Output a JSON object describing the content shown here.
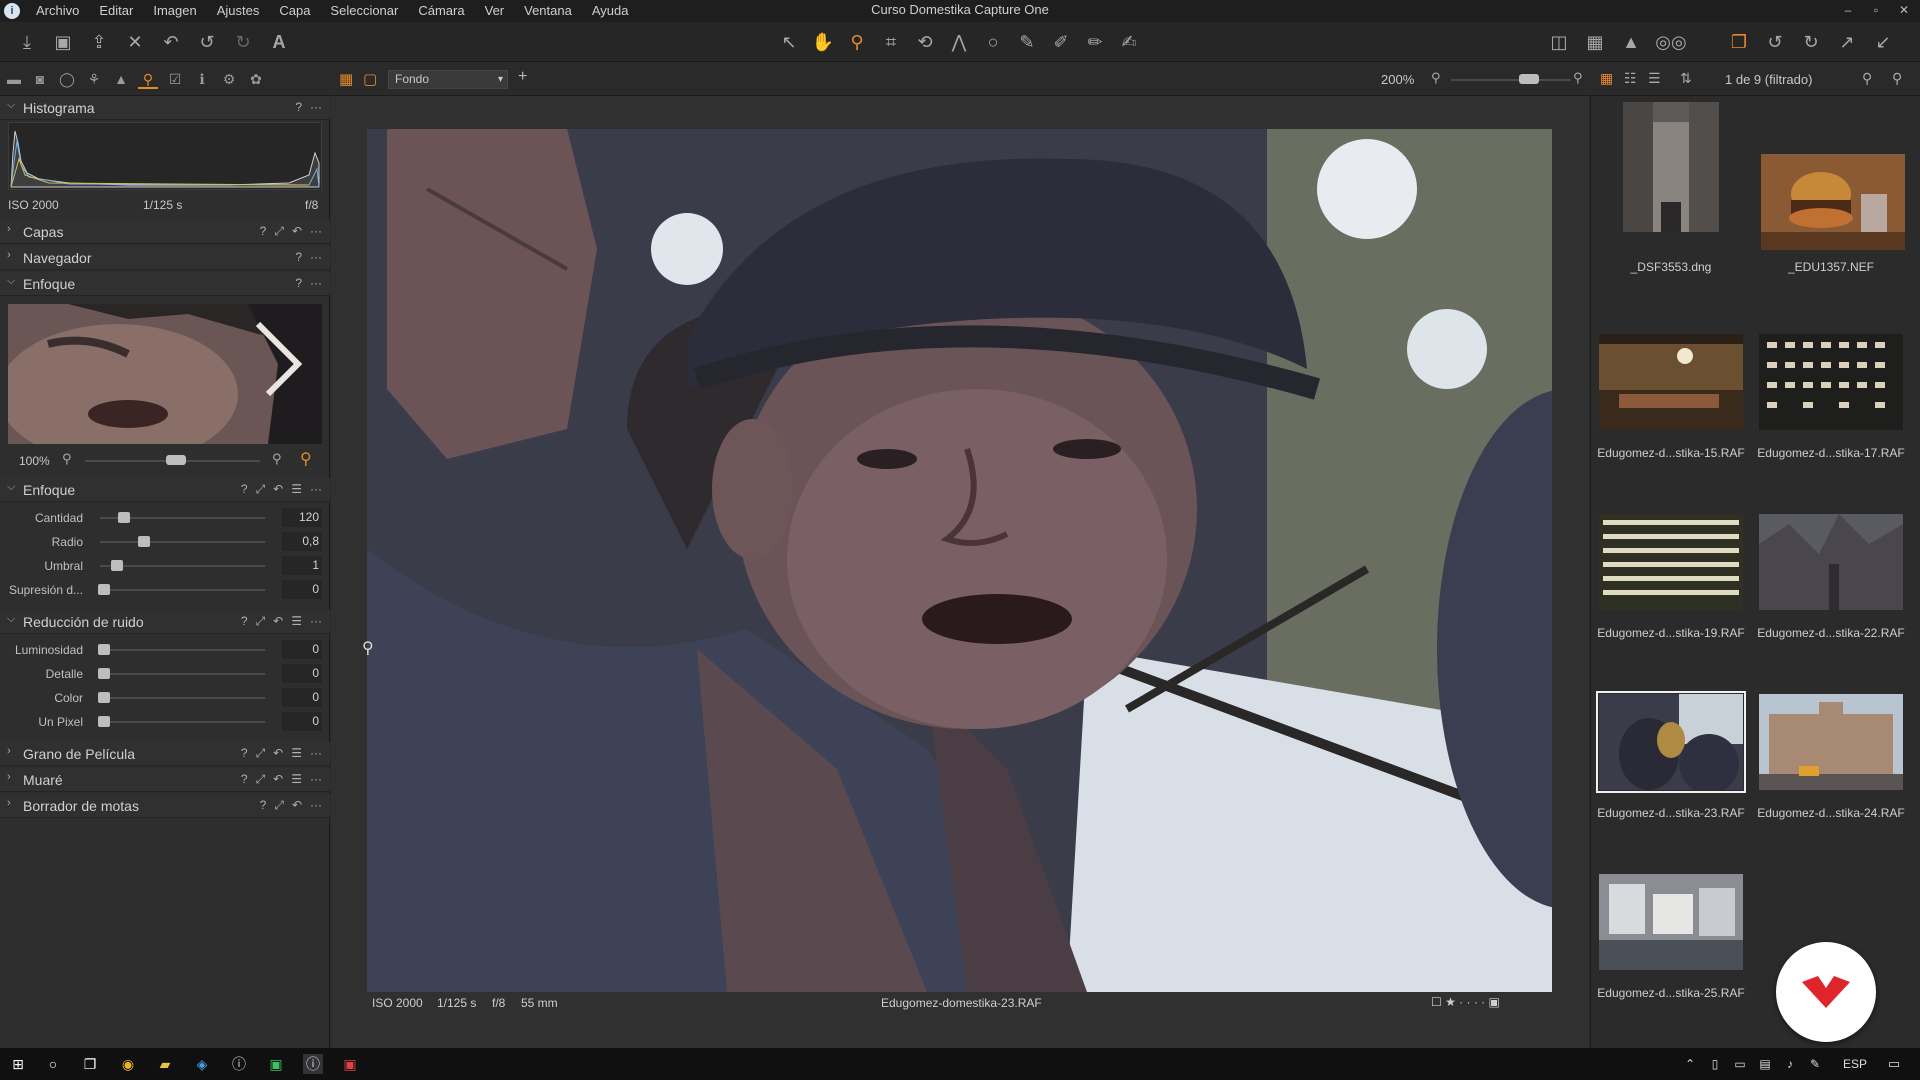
{
  "app": {
    "title": "Curso Domestika Capture One",
    "menu": [
      "Archivo",
      "Editar",
      "Imagen",
      "Ajustes",
      "Capa",
      "Seleccionar",
      "Cámara",
      "Ver",
      "Ventana",
      "Ayuda"
    ],
    "window_controls": [
      "–",
      "▫",
      "✕"
    ]
  },
  "accent_color": "#e6892d",
  "left_panel": {
    "histogram": {
      "title": "Histograma",
      "iso": "ISO 2000",
      "shutter": "1/125 s",
      "aperture": "f/8"
    },
    "layers": {
      "title": "Capas"
    },
    "navigator": {
      "title": "Navegador"
    },
    "focus_tool": {
      "title": "Enfoque",
      "zoom": "100%"
    },
    "sharpening": {
      "title": "Enfoque",
      "sliders": [
        {
          "label": "Cantidad",
          "value": "120",
          "level": 0.12
        },
        {
          "label": "Radio",
          "value": "0,8",
          "level": 0.24
        },
        {
          "label": "Umbral",
          "value": "1",
          "level": 0.08
        },
        {
          "label": "Supresión d...",
          "value": "0",
          "level": 0.0
        }
      ]
    },
    "noise_reduction": {
      "title": "Reducción de ruido",
      "sliders": [
        {
          "label": "Luminosidad",
          "value": "0",
          "level": 0.0
        },
        {
          "label": "Detalle",
          "value": "0",
          "level": 0.0
        },
        {
          "label": "Color",
          "value": "0",
          "level": 0.0
        },
        {
          "label": "Un Pixel",
          "value": "0",
          "level": 0.0
        }
      ]
    },
    "film_grain": {
      "title": "Grano de Película"
    },
    "moire": {
      "title": "Muaré"
    },
    "spot_removal": {
      "title": "Borrador de motas"
    }
  },
  "viewer": {
    "style_select": "Fondo",
    "zoom": "200%",
    "iso": "ISO 2000",
    "shutter": "1/125 s",
    "aperture": "f/8",
    "focal": "55 mm",
    "filename": "Edugomez-domestika-23.RAF"
  },
  "browser": {
    "count": "1 de 9 (filtrado)",
    "items": [
      {
        "name": "_DSF3553.dng"
      },
      {
        "name": "_EDU1357.NEF"
      },
      {
        "name": "Edugomez-d...stika-15.RAF"
      },
      {
        "name": "Edugomez-d...stika-17.RAF"
      },
      {
        "name": "Edugomez-d...stika-19.RAF"
      },
      {
        "name": "Edugomez-d...stika-22.RAF"
      },
      {
        "name": "Edugomez-d...stika-23.RAF"
      },
      {
        "name": "Edugomez-d...stika-24.RAF"
      },
      {
        "name": "Edugomez-d...stika-25.RAF"
      }
    ]
  },
  "taskbar": {
    "lang": "ESP"
  }
}
